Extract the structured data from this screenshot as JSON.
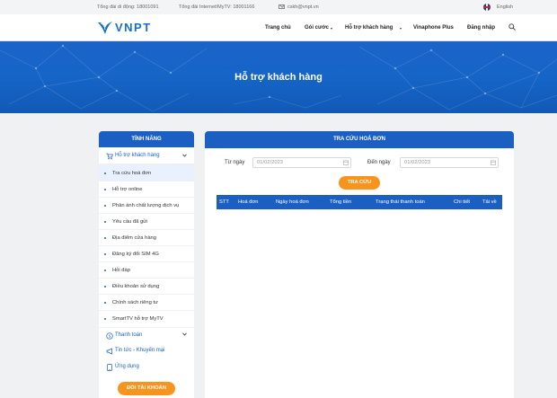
{
  "topbar": {
    "mobile_hotline": "Tổng đài di động: 18001091",
    "internet_hotline": "Tổng đài Internet/MyTV: 18001166",
    "email": "cskh@vnpt.vn",
    "language": "English"
  },
  "header": {
    "logo_text": "VNPT",
    "nav": {
      "home": "Trang chủ",
      "packages": "Gói cước",
      "support": "Hỗ trợ khách hàng",
      "vinaphone_plus": "Vinaphone Plus",
      "login": "Đăng nhập"
    }
  },
  "banner": {
    "title": "Hỗ trợ khách hàng"
  },
  "sidebar": {
    "title": "TÍNH NĂNG",
    "group_support": "Hỗ trợ khách hàng",
    "items": [
      "Tra cứu hoá đơn",
      "Hỗ trợ online",
      "Phản ánh chất lượng dịch vụ",
      "Yêu cầu đã gửi",
      "Địa điểm cửa hàng",
      "Đăng ký đổi SIM 4G",
      "Hỏi đáp",
      "Điều khoản sử dụng",
      "Chính sách riêng tư",
      "SmartTV hỗ trợ MyTV"
    ],
    "group_payment": "Thanh toán",
    "group_news": "Tin tức - Khuyến mại",
    "group_apps": "Ứng dụng",
    "switch_account": "ĐỔI TÀI KHOẢN"
  },
  "panel": {
    "title": "TRA CỨU HOÁ ĐƠN",
    "from_label": "Từ ngày",
    "from_value": "01/02/2023",
    "to_label": "Đến ngày",
    "to_value": "01/02/2023",
    "search_button": "TRA CỨU",
    "columns": [
      "STT",
      "Hoá đơn",
      "Ngày hoá đơn",
      "Tổng tiền",
      "Trạng thái thanh toán",
      "Chi tiết",
      "Tải về"
    ]
  },
  "colors": {
    "primary": "#1a5fc1",
    "accent": "#f7941d",
    "banner": "#1565c7"
  }
}
